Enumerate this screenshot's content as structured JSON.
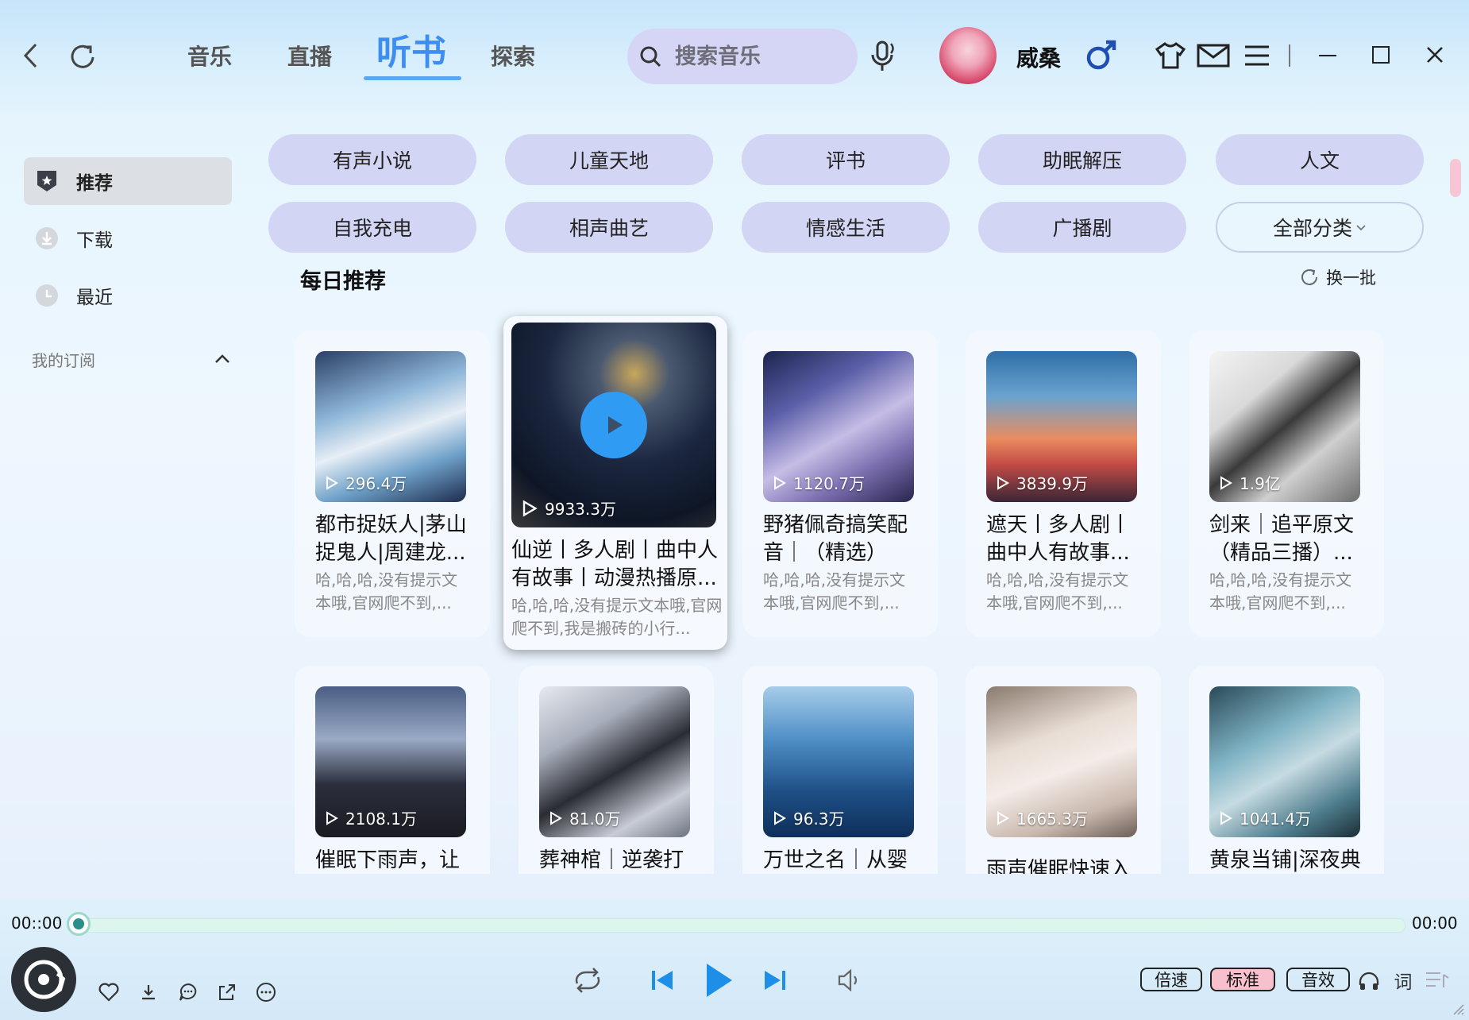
{
  "nav": {
    "tabs": [
      {
        "label": "音乐"
      },
      {
        "label": "直播"
      },
      {
        "label": "听书"
      },
      {
        "label": "探索"
      }
    ],
    "active": "听书"
  },
  "search": {
    "placeholder": "搜索音乐"
  },
  "user": {
    "name": "威桑"
  },
  "sidebar": {
    "items": [
      {
        "label": "推荐",
        "icon": "badge-icon"
      },
      {
        "label": "下载",
        "icon": "download-icon"
      },
      {
        "label": "最近",
        "icon": "clock-icon"
      }
    ],
    "subscriptions_label": "我的订阅"
  },
  "categories": [
    "有声小说",
    "儿童天地",
    "评书",
    "助眠解压",
    "人文",
    "自我充电",
    "相声曲艺",
    "情感生活",
    "广播剧",
    "全部分类"
  ],
  "section": {
    "title": "每日推荐",
    "refresh_label": "换一批"
  },
  "cards": [
    {
      "plays": "296.4万",
      "title": "都市捉妖人|茅山捉鬼人|周建龙...",
      "desc": "哈,哈,哈,没有提示文本哦,官网爬不到,..."
    },
    {
      "plays": "9933.3万",
      "title": "仙逆丨多人剧丨曲中人有故事丨动漫热播原...",
      "desc": "哈,哈,哈,没有提示文本哦,官网爬不到,我是搬砖的小行..."
    },
    {
      "plays": "1120.7万",
      "title": "野猪佩奇搞笑配音｜（精选）",
      "desc": "哈,哈,哈,没有提示文本哦,官网爬不到,..."
    },
    {
      "plays": "3839.9万",
      "title": "遮天丨多人剧丨曲中人有故事...",
      "desc": "哈,哈,哈,没有提示文本哦,官网爬不到,..."
    },
    {
      "plays": "1.9亿",
      "title": "剑来｜追平原文（精品三播）...",
      "desc": "哈,哈,哈,没有提示文本哦,官网爬不到,..."
    },
    {
      "plays": "2108.1万",
      "title": "催眠下雨声，让",
      "desc": ""
    },
    {
      "plays": "81.0万",
      "title": "葬神棺｜逆袭打",
      "desc": ""
    },
    {
      "plays": "96.3万",
      "title": "万世之名｜从婴",
      "desc": ""
    },
    {
      "plays": "1665.3万",
      "title": "雨声催眠快速入",
      "desc": ""
    },
    {
      "plays": "1041.4万",
      "title": "黄泉当铺|深夜典",
      "desc": ""
    }
  ],
  "player": {
    "time_current": "00::00",
    "time_total": "00:00",
    "progress": 0,
    "speed_label": "倍速",
    "quality_label": "标准",
    "effect_label": "音效",
    "lyrics_label": "词"
  }
}
